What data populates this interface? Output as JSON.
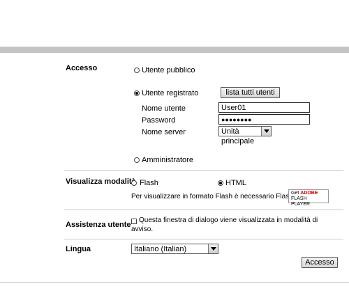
{
  "access": {
    "label": "Accesso",
    "public_user": "Utente pubblico",
    "registered_user": "Utente registrato",
    "list_users_button": "lista tutti utenti",
    "username_label": "Nome utente",
    "username_value": "User01",
    "password_label": "Password",
    "password_value": "●●●●●●●●",
    "server_label": "Nome server",
    "server_value": "Unità principale",
    "administrator": "Amministratore",
    "selected": "registered_user"
  },
  "display_mode": {
    "label": "Visualizza modalità",
    "flash": "Flash",
    "html": "HTML",
    "selected": "html",
    "note": "Per visualizzare in formato Flash è necessario Flash Player.",
    "badge_get": "Get",
    "badge_adobe": "ADOBE",
    "badge_player": "FLASH PLAYER"
  },
  "assistance": {
    "label": "Assistenza utente",
    "checkbox_text_line1": "Questa finestra di dialogo viene visualizzata in modalità di",
    "checkbox_text_line2": "avviso.",
    "checked": false
  },
  "language": {
    "label": "Lingua",
    "value": "Italiano (Italian)"
  },
  "submit_button": "Accesso"
}
